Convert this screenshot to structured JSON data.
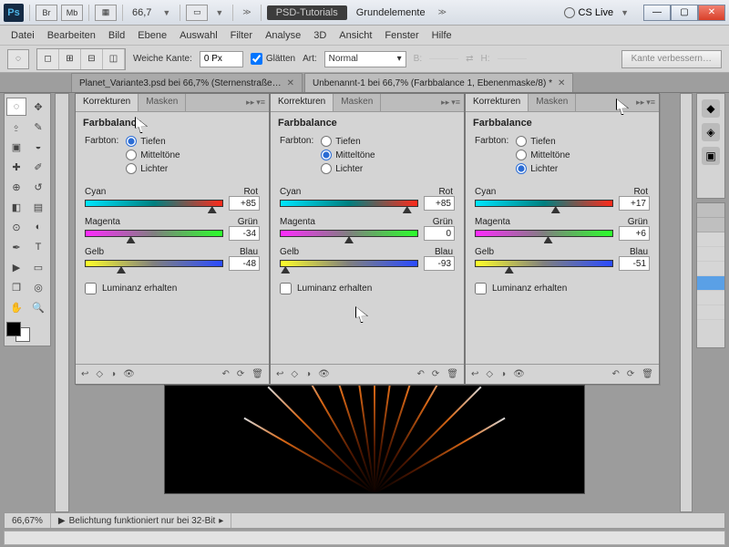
{
  "title": {
    "ps": "Ps",
    "br": "Br",
    "mb": "Mb",
    "zoom": "66,7",
    "workspace_pill": "PSD-Tutorials",
    "workspace_plain": "Grundelemente",
    "cslive": "CS Live"
  },
  "menu": [
    "Datei",
    "Bearbeiten",
    "Bild",
    "Ebene",
    "Auswahl",
    "Filter",
    "Analyse",
    "3D",
    "Ansicht",
    "Fenster",
    "Hilfe"
  ],
  "options": {
    "weiche_kante_label": "Weiche Kante:",
    "weiche_kante_value": "0 Px",
    "glatten_label": "Glätten",
    "art_label": "Art:",
    "art_value": "Normal",
    "b_label": "B:",
    "h_label": "H:",
    "kante_btn": "Kante verbessern…"
  },
  "doctabs": {
    "tab1": "Planet_Variante3.psd bei 66,7% (Sternenstraße…",
    "tab2": "Unbenannt-1 bei 66,7% (Farbbalance 1, Ebenenmaske/8) *"
  },
  "panel_common": {
    "tab_korrekturen": "Korrekturen",
    "tab_masken": "Masken",
    "title": "Farbbalance",
    "farbton_label": "Farbton:",
    "r_tiefen": "Tiefen",
    "r_mittel": "Mitteltöne",
    "r_lichter": "Lichter",
    "lab_cyan": "Cyan",
    "lab_rot": "Rot",
    "lab_magenta": "Magenta",
    "lab_gruen": "Grün",
    "lab_gelb": "Gelb",
    "lab_blau": "Blau",
    "luminanz": "Luminanz erhalten"
  },
  "panels": [
    {
      "selected": "tiefen",
      "v1": "+85",
      "v2": "-34",
      "v3": "-48",
      "t1": 85,
      "t2": -34,
      "t3": -48
    },
    {
      "selected": "mittel",
      "v1": "+85",
      "v2": "0",
      "v3": "-93",
      "t1": 85,
      "t2": 0,
      "t3": -93
    },
    {
      "selected": "lichter",
      "v1": "+17",
      "v2": "+6",
      "v3": "-51",
      "t1": 17,
      "t2": 6,
      "t3": -51
    }
  ],
  "status": {
    "zoom": "66,67%",
    "msg": "Belichtung funktioniert nur bei 32-Bit"
  }
}
